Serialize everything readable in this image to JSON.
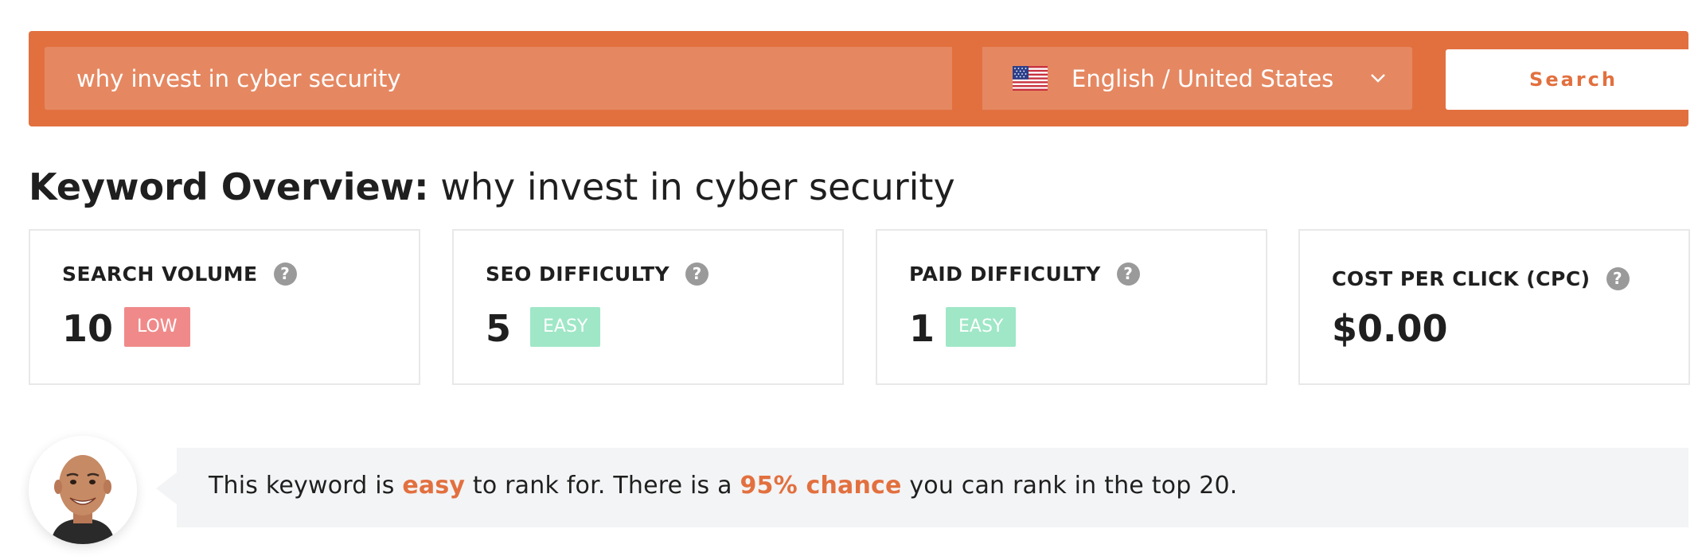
{
  "search": {
    "keyword_value": "why invest in cyber security",
    "language_label": "English / United States",
    "search_label": "Search"
  },
  "overview": {
    "title_bold": "Keyword Overview:",
    "title_keyword": "why invest in cyber security"
  },
  "metrics": [
    {
      "label": "SEARCH VOLUME",
      "value": "10",
      "badge": "LOW"
    },
    {
      "label": "SEO DIFFICULTY",
      "value": "5",
      "badge": "EASY"
    },
    {
      "label": "PAID DIFFICULTY",
      "value": "1",
      "badge": "EASY"
    },
    {
      "label": "COST PER CLICK (CPC)",
      "value": "$0.00"
    }
  ],
  "help_icon_glyph": "?",
  "insight": {
    "part1": "This keyword is ",
    "highlight1": "easy",
    "part2": " to rank for. There is a ",
    "highlight2": "95% chance",
    "part3": " you can rank in the top 20."
  },
  "colors": {
    "accent": "#e2703f",
    "low_badge": "#f08a8a",
    "easy_badge": "#9fe7c7"
  },
  "icons": [
    "us-flag-icon",
    "chevron-down-icon",
    "help-icon",
    "avatar-photo"
  ]
}
